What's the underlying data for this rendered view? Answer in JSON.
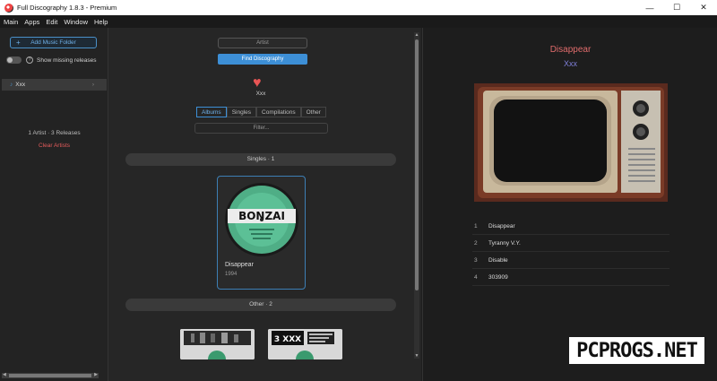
{
  "window": {
    "title": "Full Discography 1.8.3 - Premium",
    "controls": [
      "—",
      "☐",
      "✕"
    ]
  },
  "menu": [
    "Main",
    "Apps",
    "Edit",
    "Window",
    "Help"
  ],
  "sidebar": {
    "add_folder_label": "Add Music Folder",
    "show_missing_label": "Show missing releases",
    "show_missing_on": false,
    "artists": [
      {
        "name": "Xxx"
      }
    ],
    "count_text": "1 Artist · 3 Releases",
    "clear_label": "Clear Artists"
  },
  "search": {
    "artist_placeholder": "Artist",
    "find_label": "Find Discography",
    "filter_placeholder": "Filter..."
  },
  "artist": {
    "name": "Xxx"
  },
  "tabs": [
    {
      "label": "Albums",
      "active": true
    },
    {
      "label": "Singles",
      "active": false
    },
    {
      "label": "Compilations",
      "active": false
    },
    {
      "label": "Other",
      "active": false
    }
  ],
  "sections": {
    "singles_label": "Singles · 1",
    "other_label": "Other · 2"
  },
  "single": {
    "title": "Disappear",
    "year": "1994",
    "label_text": "BONZAI"
  },
  "other_thumbs": [
    {
      "text": ""
    },
    {
      "text": "3 XXX"
    }
  ],
  "release": {
    "title": "Disappear",
    "artist": "Xxx",
    "tracks": [
      {
        "num": "1",
        "title": "Disappear"
      },
      {
        "num": "2",
        "title": "Tyranny V.Y."
      },
      {
        "num": "3",
        "title": "Disable"
      },
      {
        "num": "4",
        "title": "303909"
      }
    ]
  },
  "watermark": "PCPROGS.NET",
  "colors": {
    "accent_blue": "#3d8fd6",
    "heart_red": "#e85555",
    "title_red": "#e06c6c",
    "artist_purple": "#7f7fd9",
    "clear_red": "#e35b5b"
  }
}
